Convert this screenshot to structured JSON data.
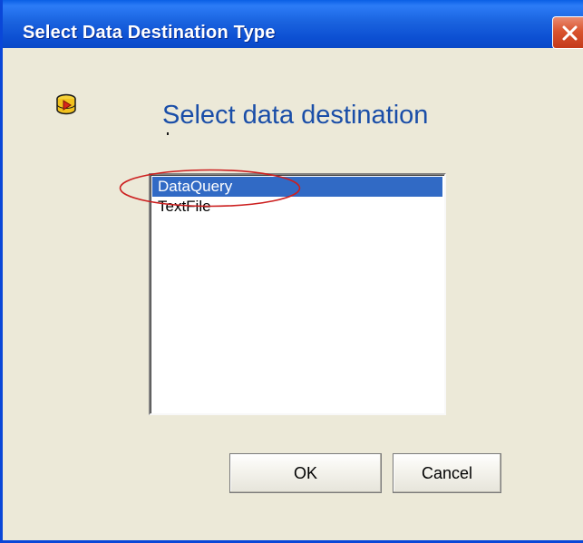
{
  "window": {
    "title": "Select Data Destination Type",
    "close_icon": "close-icon"
  },
  "content": {
    "icon": "database-icon",
    "heading": "Select data destination"
  },
  "listbox": {
    "items": [
      {
        "label": "DataQuery",
        "selected": true
      },
      {
        "label": "TextFile",
        "selected": false
      }
    ]
  },
  "buttons": {
    "ok_label": "OK",
    "cancel_label": "Cancel"
  },
  "colors": {
    "titlebar": "#0a5fe5",
    "dialog_bg": "#ece9d8",
    "selection": "#316ac5",
    "heading": "#1a4ea8",
    "annotation": "#cc1f1f"
  }
}
